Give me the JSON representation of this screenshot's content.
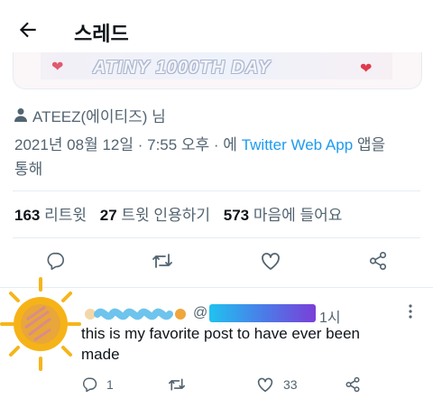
{
  "header": {
    "title": "스레드"
  },
  "banner": {
    "text": "ATINY 1000TH DAY"
  },
  "tweet": {
    "author_line": "ATEEZ(에이티즈) 님",
    "date_time": "2021년 08월 12일 · 7:55 오후 · 에",
    "source_link": "Twitter Web App",
    "source_suffix_line1": "앱을",
    "source_suffix_line2": "통해"
  },
  "stats": {
    "retweets_count": "163",
    "retweets_label": "리트윗",
    "quotes_count": "27",
    "quotes_label": "트윗 인용하기",
    "likes_count": "573",
    "likes_label": "마음에 들어요"
  },
  "reply": {
    "handle_prefix": "@",
    "time": "1시",
    "text_line1": "this is my favorite post to have ever been",
    "text_line2": "made",
    "reply_count": "1",
    "retweet_count": "",
    "like_count": "33"
  },
  "colors": {
    "link": "#1d9bf0",
    "muted": "#536471",
    "divider": "#e6ecf0"
  },
  "icons": [
    "back-arrow-icon",
    "person-icon",
    "reply-icon",
    "retweet-icon",
    "like-icon",
    "share-icon",
    "more-icon"
  ]
}
